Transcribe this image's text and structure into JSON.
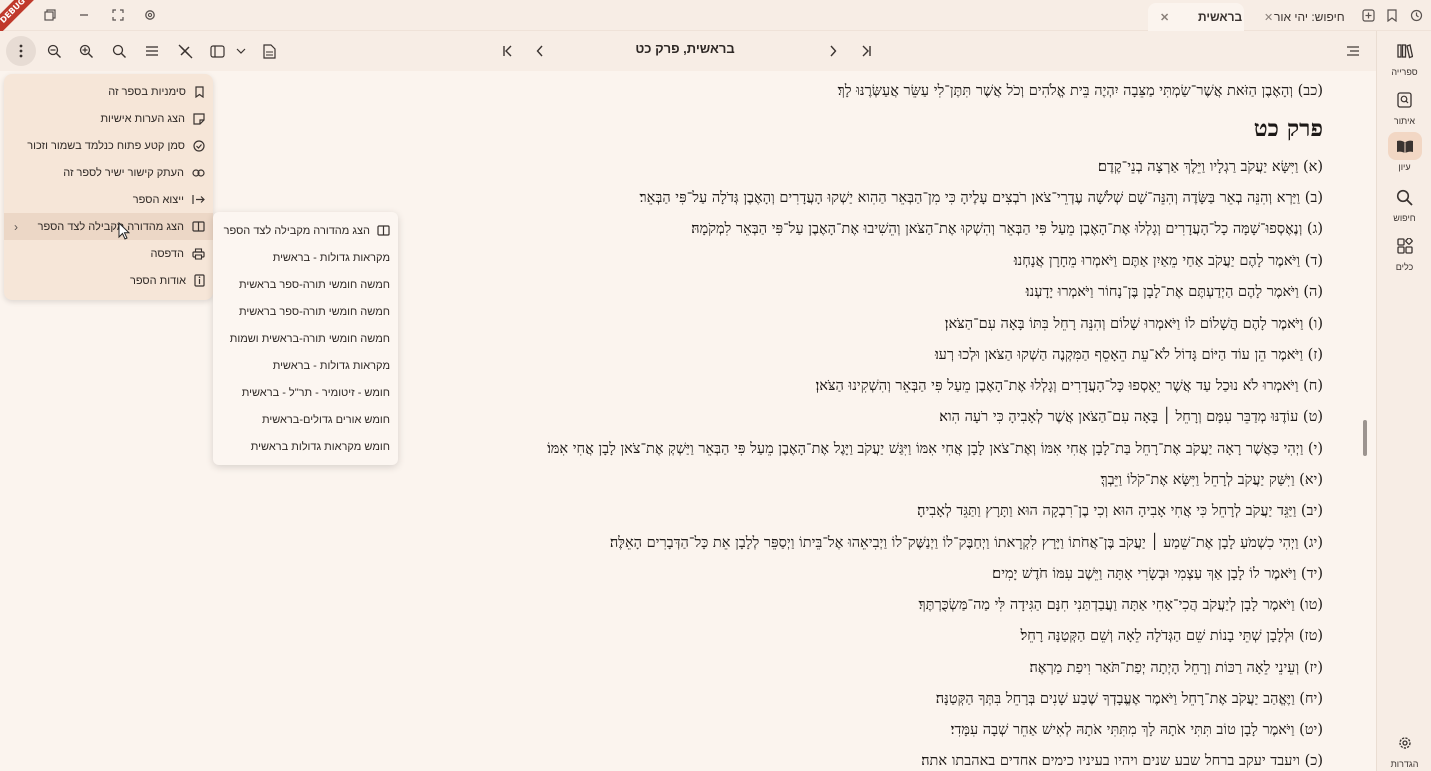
{
  "window": {
    "tabs": [
      {
        "label": "בראשית",
        "active": true
      },
      {
        "label": "חיפוש: יהי אור",
        "active": false
      }
    ],
    "badge": "DEBUG"
  },
  "toolbar": {
    "chapter_title": "בראשית, פרק כט"
  },
  "sidebar": {
    "items": [
      {
        "label": "ספרייה",
        "icon": "library-icon"
      },
      {
        "label": "איתור",
        "icon": "find-ref-icon"
      },
      {
        "label": "עיון",
        "icon": "book-open-icon",
        "active": true
      },
      {
        "label": "חיפוש",
        "icon": "search-icon"
      },
      {
        "label": "כלים",
        "icon": "tools-icon"
      },
      {
        "label": "הגדרות",
        "icon": "settings-icon"
      }
    ]
  },
  "content": {
    "top_verse": "(כב) וְהָאֶבֶן הַזֹּאת אֲשֶׁר־שַׂמְתִּי מַצֵּבָה יִהְיֶה בֵּית אֱלֹהִים וְכֹל אֲשֶׁר תִּתֶּן־לִי עַשֵּׂר אֲעַשְּׂרֶנּוּ לָךְ׃",
    "chapter_heading": "פרק כט",
    "verses": [
      "(א) וַיִּשָּׂא יַעֲקֹב רַגְלָיו וַיֵּלֶךְ אַרְצָה בְנֵי־קֶדֶם׃",
      "(ב) וַיַּרְא וְהִנֵּה בְאֵר בַּשָּׂדֶה וְהִנֵּה־שָׁם שְׁלֹשָׁה עֶדְרֵי־צֹאן רֹבְצִים עָלֶיהָ כִּי מִן־הַבְּאֵר הַהִוא יַשְׁקוּ הָעֲדָרִים וְהָאֶבֶן גְּדֹלָה עַל־פִּי הַבְּאֵר׃",
      "(ג) וְנֶאֶסְפוּ־שָׁמָּה כָל־הָעֲדָרִים וְגָלְלוּ אֶת־הָאֶבֶן מֵעַל פִּי הַבְּאֵר וְהִשְׁקוּ אֶת־הַצֹּאן וְהֵשִׁיבוּ אֶת־הָאֶבֶן עַל־פִּי הַבְּאֵר לִמְקֹמָהּ׃",
      "(ד) וַיֹּאמֶר לָהֶם יַעֲקֹב אַחַי מֵאַיִן אַתֶּם וַיֹּאמְרוּ מֵחָרָן אֲנָחְנוּ׃",
      "(ה) וַיֹּאמֶר לָהֶם הַיְדַעְתֶּם אֶת־לָבָן בֶּן־נָחוֹר וַיֹּאמְרוּ יָדָעְנוּ׃",
      "(ו) וַיֹּאמֶר לָהֶם הֲשָׁלוֹם לוֹ וַיֹּאמְרוּ שָׁלוֹם וְהִנֵּה רָחֵל בִּתּוֹ בָּאָה עִם־הַצֹּאן׃",
      "(ז) וַיֹּאמֶר הֵן עוֹד הַיּוֹם גָּדוֹל לֹא־עֵת הֵאָסֵף הַמִּקְנֶה הַשְׁקוּ הַצֹּאן וּלְכוּ רְעוּ׃",
      "(ח) וַיֹּאמְרוּ לֹא נוּכַל עַד אֲשֶׁר יֵאָסְפוּ כָּל־הָעֲדָרִים וְגָלְלוּ אֶת־הָאֶבֶן מֵעַל פִּי הַבְּאֵר וְהִשְׁקִינוּ הַצֹּאן׃",
      "(ט) עוֹדֶנּוּ מְדַבֵּר עִמָּם וְרָחֵל ׀ בָּאָה עִם־הַצֹּאן אֲשֶׁר לְאָבִיהָ כִּי רֹעָה הִוא׃",
      "(י) וַיְהִי כַּאֲשֶׁר רָאָה יַעֲקֹב אֶת־רָחֵל בַּת־לָבָן אֲחִי אִמּוֹ וְאֶת־צֹאן לָבָן אֲחִי אִמּוֹ וַיִּגַּשׁ יַעֲקֹב וַיָּגֶל אֶת־הָאֶבֶן מֵעַל פִּי הַבְּאֵר וַיַּשְׁקְ אֶת־צֹאן לָבָן אֲחִי אִמּוֹ׃",
      "(יא) וַיִּשַּׁק יַעֲקֹב לְרָחֵל וַיִּשָּׂא אֶת־קֹלוֹ וַיֵּבְךְּ׃",
      "(יב) וַיַּגֵּד יַעֲקֹב לְרָחֵל כִּי אֲחִי אָבִיהָ הוּא וְכִי בֶן־רִבְקָה הוּא וַתָּרָץ וַתַּגֵּד לְאָבִיהָ׃",
      "(יג) וַיְהִי כִשְׁמֹעַ לָבָן אֶת־שֵׁמַע ׀ יַעֲקֹב בֶּן־אֲחֹתוֹ וַיָּרָץ לִקְרָאתוֹ וַיְחַבֶּק־לוֹ וַיְנַשֶּׁק־לוֹ וַיְבִיאֵהוּ אֶל־בֵּיתוֹ וַיְסַפֵּר לְלָבָן אֵת כָּל־הַדְּבָרִים הָאֵלֶּה׃",
      "(יד) וַיֹּאמֶר לוֹ לָבָן אַךְ עַצְמִי וּבְשָׂרִי אָתָּה וַיֵּשֶׁב עִמּוֹ חֹדֶשׁ יָמִים׃",
      "(טו) וַיֹּאמֶר לָבָן לְיַעֲקֹב הֲכִי־אָחִי אַתָּה וַעֲבַדְתַּנִי חִנָּם הַגִּידָה לִּי מַה־מַּשְׂכֻּרְתֶּךָ׃",
      "(טז) וּלְלָבָן שְׁתֵּי בָנוֹת שֵׁם הַגְּדֹלָה לֵאָה וְשֵׁם הַקְּטַנָּה רָחֵל׃",
      "(יז) וְעֵינֵי לֵאָה רַכּוֹת וְרָחֵל הָיְתָה יְפַת־תֹּאַר וִיפַת מַרְאֶה׃",
      "(יח) וַיֶּאֱהַב יַעֲקֹב אֶת־רָחֵל וַיֹּאמֶר אֶעֱבָדְךָ שֶׁבַע שָׁנִים בְּרָחֵל בִּתְּךָ הַקְּטַנָּה׃",
      "(יט) וַיֹּאמֶר לָבָן טוֹב תִּתִּי אֹתָהּ לָךְ מִתִּתִּי אֹתָהּ לְאִישׁ אַחֵר שְׁבָה עִמָּדִי׃",
      "(כ) ויעבד יעקב ברחל שבע שנים ויהיו בעיניו כימים אחדים באהבתו אתה׃"
    ]
  },
  "menu": {
    "items": [
      {
        "label": "סימניות בספר זה",
        "icon": "bookmark-icon"
      },
      {
        "label": "הצג הערות אישיות",
        "icon": "note-icon"
      },
      {
        "label": "סמן קטע פתוח כנלמד בשמור וזכור",
        "icon": "check-circle-icon"
      },
      {
        "label": "העתק קישור ישיר לספר זה",
        "icon": "link-icon"
      },
      {
        "label": "ייצוא הספר",
        "icon": "export-icon"
      },
      {
        "label": "הצג מהדורה מקבילה לצד הספר",
        "icon": "parallel-book-icon",
        "submenu": true
      },
      {
        "label": "הדפסה",
        "icon": "print-icon"
      },
      {
        "label": "אודות הספר",
        "icon": "info-icon"
      }
    ]
  },
  "submenu": {
    "items": [
      {
        "label": "הצג מהדורה מקבילה לצד הספר",
        "icon": "parallel-book-icon"
      },
      {
        "label": "מקראות גדולות - בראשית"
      },
      {
        "label": "חמשה חומשי תורה-ספר בראשית"
      },
      {
        "label": "חמשה חומשי תורה-ספר בראשית"
      },
      {
        "label": "חמשה חומשי תורה-בראשית ושמות"
      },
      {
        "label": "מקראות גדולות - בראשית"
      },
      {
        "label": "חומש - זיטומיר - תר\"ל - בראשית"
      },
      {
        "label": "חומש אורים גדולים-בראשית"
      },
      {
        "label": "חומש מקראות גדולות בראשית"
      }
    ]
  }
}
